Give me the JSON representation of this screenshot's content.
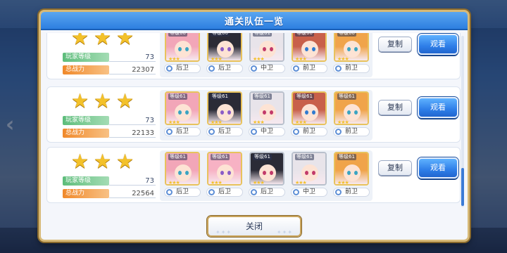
{
  "dialog": {
    "title": "通关队伍一览",
    "close_label": "关闭"
  },
  "labels": {
    "player_level": "玩家等级",
    "total_power": "总战力",
    "copy": "复制",
    "view": "观看"
  },
  "teams": [
    {
      "stars": 3,
      "player_level": "73",
      "total_power": "22307",
      "members": [
        {
          "level": "等级60",
          "position": "后卫",
          "hair": "#f2a6b8",
          "eye": "#3aa4c2",
          "frame": "gold"
        },
        {
          "level": "等级60",
          "position": "后卫",
          "hair": "#2b2b36",
          "eye": "#8a5cc7",
          "frame": "gold"
        },
        {
          "level": "等级61",
          "position": "中卫",
          "hair": "#e8e4ea",
          "eye": "#c23a6a",
          "frame": "silver"
        },
        {
          "level": "等级60",
          "position": "前卫",
          "hair": "#c8604a",
          "eye": "#2f7bd0",
          "frame": "gold"
        },
        {
          "level": "等级60",
          "position": "前卫",
          "hair": "#f0a44a",
          "eye": "#3aa4c2",
          "frame": "gold"
        }
      ]
    },
    {
      "stars": 3,
      "player_level": "73",
      "total_power": "22133",
      "members": [
        {
          "level": "等级61",
          "position": "后卫",
          "hair": "#f2a6b8",
          "eye": "#3aa4c2",
          "frame": "gold"
        },
        {
          "level": "等级61",
          "position": "后卫",
          "hair": "#2b2b36",
          "eye": "#8a5cc7",
          "frame": "gold"
        },
        {
          "level": "等级61",
          "position": "中卫",
          "hair": "#e8e4ea",
          "eye": "#c23a6a",
          "frame": "silver"
        },
        {
          "level": "等级61",
          "position": "前卫",
          "hair": "#c8604a",
          "eye": "#2f7bd0",
          "frame": "gold"
        },
        {
          "level": "等级61",
          "position": "前卫",
          "hair": "#f0a44a",
          "eye": "#3aa4c2",
          "frame": "gold"
        }
      ]
    },
    {
      "stars": 3,
      "player_level": "73",
      "total_power": "22564",
      "members": [
        {
          "level": "等级61",
          "position": "后卫",
          "hair": "#f2a6b8",
          "eye": "#3aa4c2",
          "frame": "gold"
        },
        {
          "level": "等级61",
          "position": "后卫",
          "hair": "#f7b2c4",
          "eye": "#8a5cc7",
          "frame": "gold"
        },
        {
          "level": "等级61",
          "position": "后卫",
          "hair": "#2b2b36",
          "eye": "#c23a6a",
          "frame": "silver"
        },
        {
          "level": "等级61",
          "position": "中卫",
          "hair": "#e8e4ea",
          "eye": "#c23a6a",
          "frame": "silver"
        },
        {
          "level": "等级61",
          "position": "前卫",
          "hair": "#f0a44a",
          "eye": "#3aa4c2",
          "frame": "gold"
        }
      ]
    }
  ],
  "scroll_position": 0.78,
  "colors": {
    "header_blue": "#2d7fe0",
    "view_button": "#2e7ee8",
    "star_gold": "#f3c12a",
    "level_green": "#5dbd7b",
    "power_orange": "#f0892b"
  }
}
